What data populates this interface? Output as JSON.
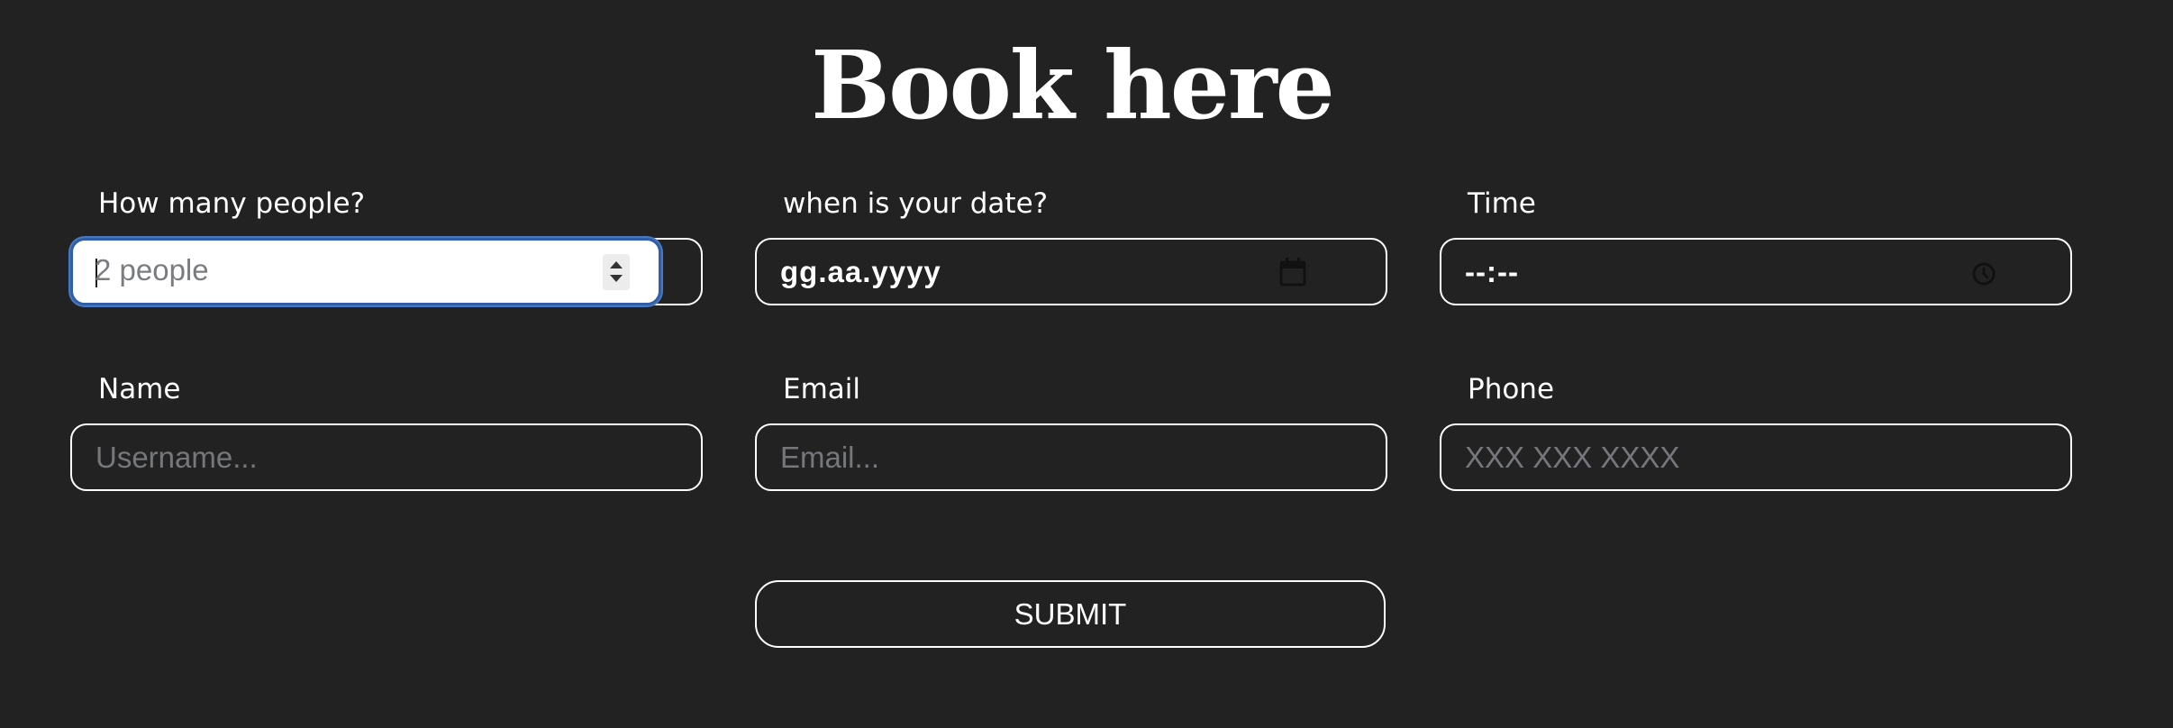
{
  "page": {
    "title": "Book here",
    "background": "#222222",
    "accent_focus": "#2f5fa8"
  },
  "form": {
    "people": {
      "label": "How many people?",
      "placeholder": "2 people",
      "state": "focused",
      "icon": "spinner-arrows-icon"
    },
    "date": {
      "label": "when is your date?",
      "value": "gg.aa.yyyy",
      "icon": "calendar-icon"
    },
    "time": {
      "label": "Time",
      "value": "--:--",
      "icon": "clock-icon"
    },
    "name": {
      "label": "Name",
      "placeholder": "Username..."
    },
    "email": {
      "label": "Email",
      "placeholder": "Email..."
    },
    "phone": {
      "label": "Phone",
      "placeholder": "XXX XXX XXXX"
    },
    "submit_label": "SUBMIT"
  }
}
